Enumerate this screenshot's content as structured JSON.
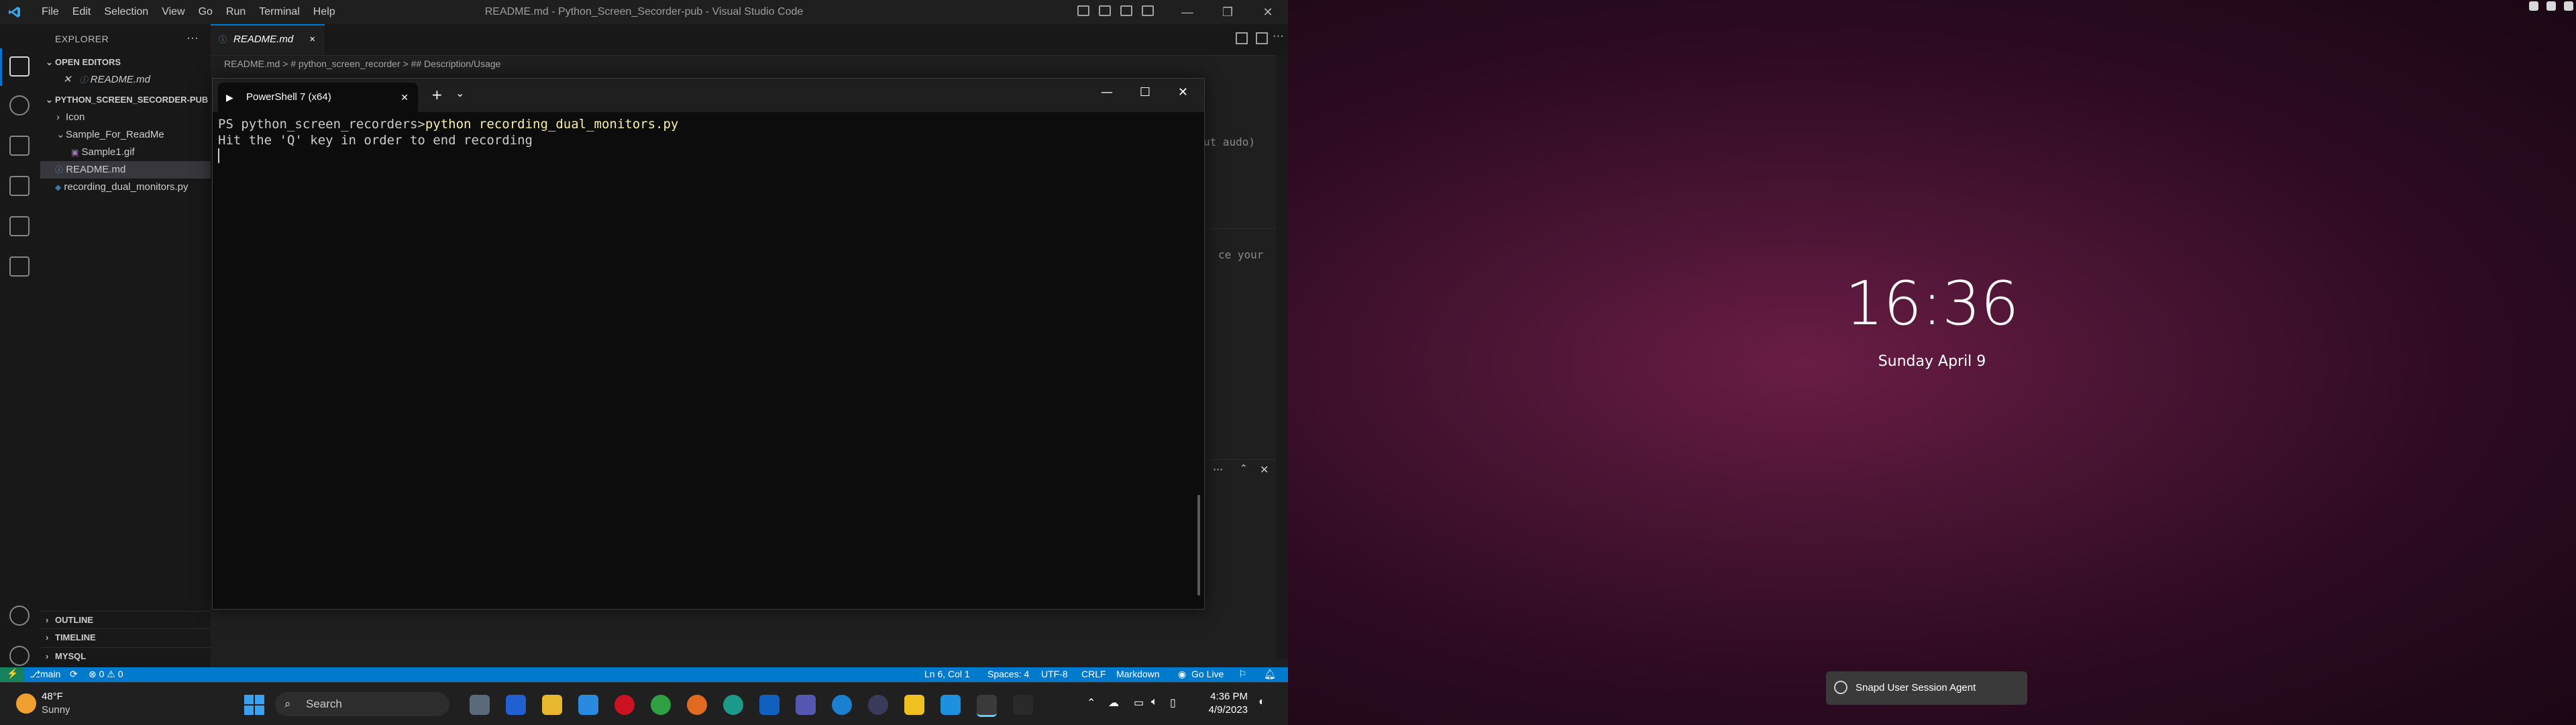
{
  "vscode": {
    "menu": [
      "File",
      "Edit",
      "Selection",
      "View",
      "Go",
      "Run",
      "Terminal",
      "Help"
    ],
    "window_title": "README.md - Python_Screen_Secorder-pub - Visual Studio Code",
    "explorer": {
      "title": "EXPLORER",
      "open_editors_label": "OPEN EDITORS",
      "open_editor_file": "README.md",
      "project_label": "PYTHON_SCREEN_SECORDER-PUB",
      "items": [
        "Icon",
        "Sample_For_ReadMe",
        "Sample1.gif",
        "README.md",
        "recording_dual_monitors.py"
      ],
      "outline_label": "OUTLINE",
      "timeline_label": "TIMELINE",
      "mysql_label": "MYSQL"
    },
    "tab": {
      "label": "README.md",
      "close": "×"
    },
    "breadcrumb": "README.md > # python_screen_recorder > ## Description/Usage",
    "ghost_text_right": "ut audo)",
    "ghost_text_right2": "ce your"
  },
  "terminal": {
    "tab_title": "PowerShell 7 (x64)",
    "prompt": "PS python_screen_recorders>",
    "command": "python recording_dual_monitors.py",
    "output": "Hit the 'Q' key in order to end recording"
  },
  "statusbar": {
    "branch": "main",
    "problems": "⊗ 0 ⚠ 0",
    "position": "Ln 6, Col 1",
    "spaces": "Spaces: 4",
    "encoding": "UTF-8",
    "eol": "CRLF",
    "language": "Markdown",
    "golive": "Go Live"
  },
  "taskbar": {
    "weather_temp": "48°F",
    "weather_desc": "Sunny",
    "search_label": "Search",
    "time": "4:36 PM",
    "date": "4/9/2023"
  },
  "lockscreen": {
    "time": "16:36",
    "date": "Sunday April 9",
    "notification": "Snapd User Session Agent"
  }
}
